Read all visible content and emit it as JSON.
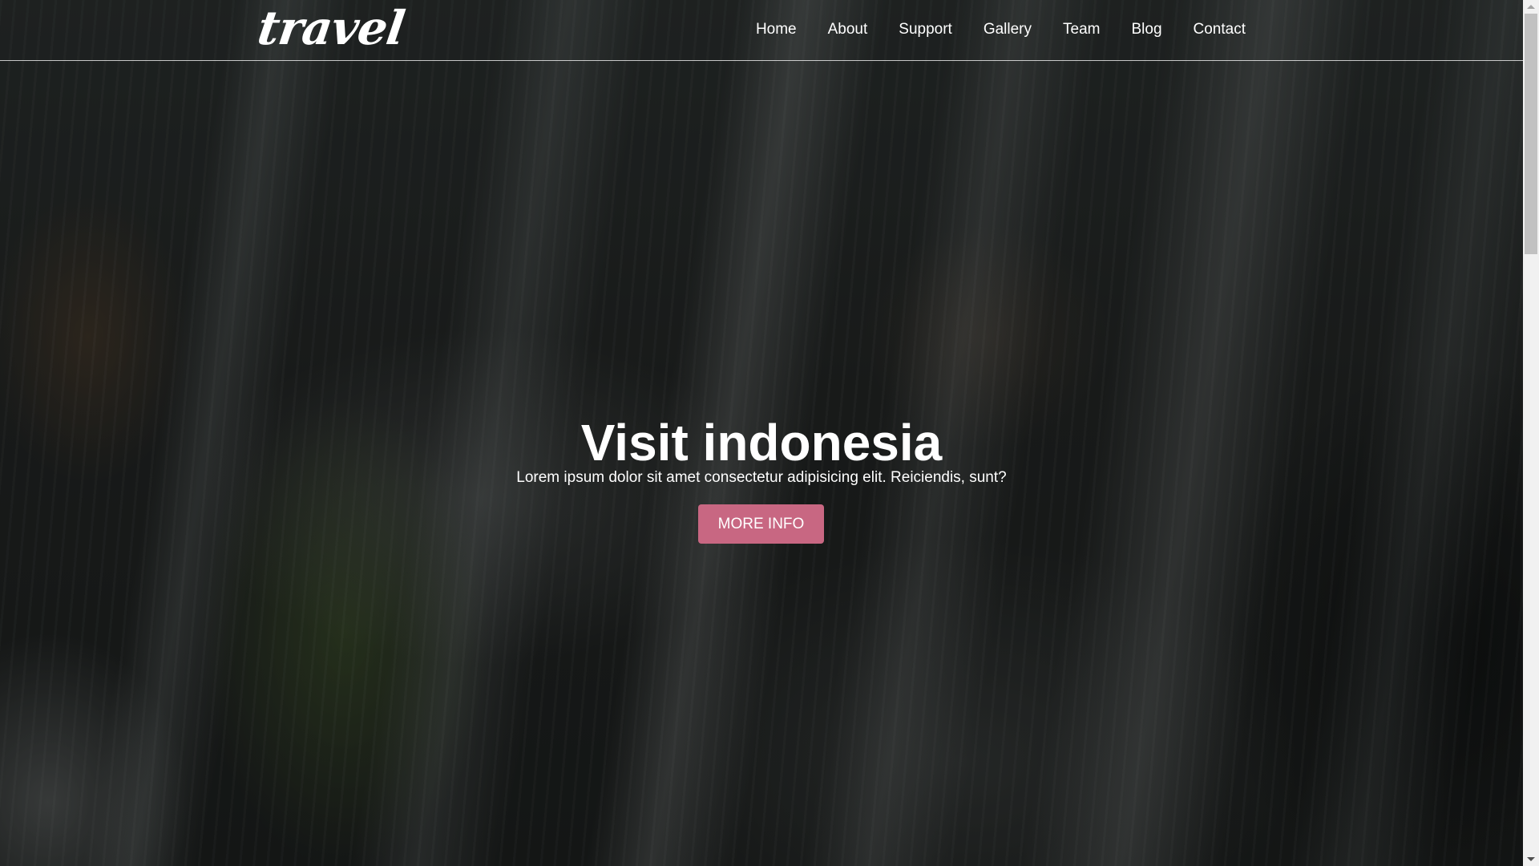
{
  "brand": {
    "logo_text": "travel"
  },
  "nav": {
    "items": [
      {
        "label": "Home"
      },
      {
        "label": "About"
      },
      {
        "label": "Support"
      },
      {
        "label": "Gallery"
      },
      {
        "label": "Team"
      },
      {
        "label": "Blog"
      },
      {
        "label": "Contact"
      }
    ]
  },
  "hero": {
    "title": "Visit indonesia",
    "subtitle": "Lorem ipsum dolor sit amet consectetur adipisicing elit. Reiciendis, sunt?",
    "button_label": "MORE INFO",
    "button_color": "#c86782",
    "background_description": "waterfall-image"
  },
  "colors": {
    "text": "#ffffff",
    "accent": "#c86782"
  }
}
